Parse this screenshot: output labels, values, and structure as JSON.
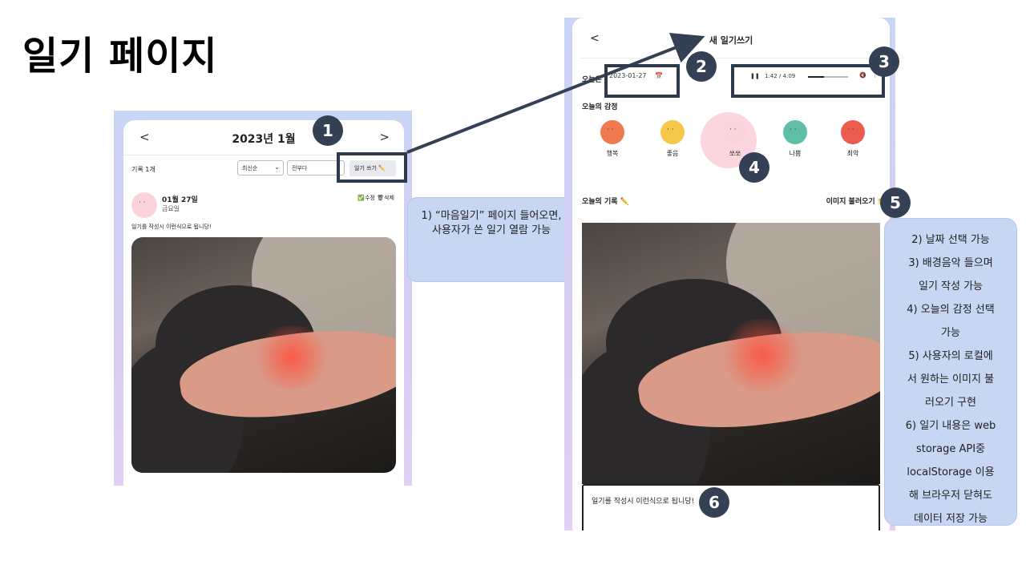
{
  "slide": {
    "title": "일기 페이지"
  },
  "left_phone": {
    "header": {
      "prev": "<",
      "month": "2023년 1월",
      "next": ">"
    },
    "record_count": "기록 1개",
    "sort_select": "최신순",
    "filter_select": "전부다",
    "write_button": "일기 쓰기 ✏️",
    "entry": {
      "date": "01월 27일",
      "day": "금요일",
      "edit": "✅수정",
      "delete": "🗑삭제",
      "text": "일기를 작성시 이런식으로 됩니당!"
    }
  },
  "bubble1": {
    "text": "1)  “마음일기” 페이지 들어오면, 사용자가 쓴 일기 열람 가능"
  },
  "right_phone": {
    "back": "<",
    "title": "새 일기쓰기",
    "today_label": "오늘은",
    "date_value": "2023-01-27",
    "calendar_icon": "📅",
    "audio": {
      "play": "❚❚",
      "time": "1:42 / 4:09",
      "mute": "🔇",
      "more": "⋮",
      "progress": 0.4
    },
    "emotion_label": "오늘의 감정",
    "emotions": [
      {
        "label": "행복",
        "color": "#f07a4f"
      },
      {
        "label": "좋음",
        "color": "#f5c84a"
      },
      {
        "label": "쏘쏘",
        "color": "#fbd3da"
      },
      {
        "label": "나쁨",
        "color": "#5ebfa6"
      },
      {
        "label": "최악",
        "color": "#ec5b4f"
      }
    ],
    "record_label": "오늘의 기록 ✏️",
    "load_image": "이미지 불러오기 📁",
    "diary_text": "일기를 작성시 이런식으로 됩니당!"
  },
  "badges": [
    "1",
    "2",
    "3",
    "4",
    "5",
    "6"
  ],
  "notes": {
    "lines": [
      "2) 날짜 선택 가능",
      "3) 배경음악 들으며",
      "일기 작성 가능",
      "4) 오늘의 감정 선택",
      "가능",
      "5) 사용자의 로컬에",
      "서 원하는 이미지 불",
      "러오기 구현",
      "6) 일기 내용은 web",
      "storage API중",
      "localStorage 이용",
      "해 브라우저 닫혀도",
      "데이터 저장 가능"
    ]
  }
}
